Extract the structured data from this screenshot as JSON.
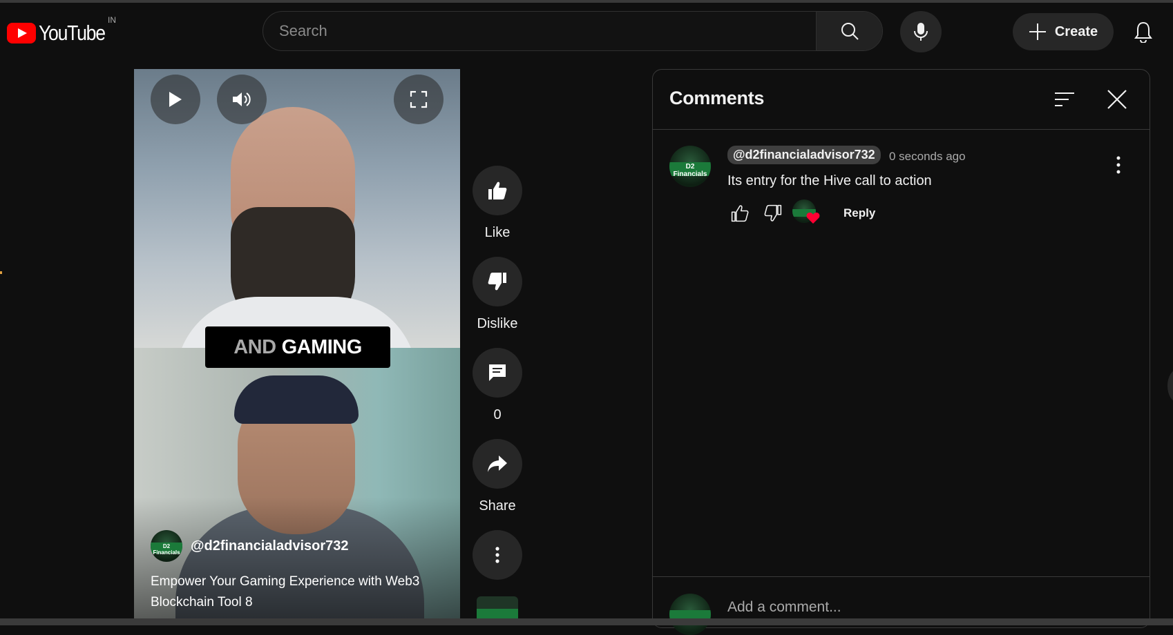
{
  "header": {
    "logo_text": "YouTube",
    "region": "IN",
    "search_placeholder": "Search",
    "create_label": "Create"
  },
  "video": {
    "caption_part1": "AND",
    "caption_part2": "GAMING",
    "channel": "@d2financialadvisor732",
    "title": "Empower Your Gaming Experience with Web3 Blockchain Tool 8"
  },
  "actions": {
    "like_label": "Like",
    "dislike_label": "Dislike",
    "comments_count": "0",
    "share_label": "Share"
  },
  "comments": {
    "title": "Comments",
    "items": [
      {
        "author": "@d2financialadvisor732",
        "time": "0 seconds ago",
        "text": "Its entry for the Hive call to action",
        "reply_label": "Reply"
      }
    ],
    "add_placeholder": "Add a comment..."
  },
  "avatar": {
    "line1": "D2",
    "line2": "Financials"
  },
  "colors": {
    "brand_red": "#ff0000",
    "background": "#0f0f0f",
    "surface": "#272727",
    "heart": "#ff0033"
  },
  "icons": [
    "play-icon",
    "volume-icon",
    "fullscreen-icon",
    "thumb-up-icon",
    "thumb-down-icon",
    "comment-icon",
    "share-icon",
    "more-vert-icon",
    "search-icon",
    "mic-icon",
    "plus-icon",
    "bell-icon",
    "sort-icon",
    "close-icon",
    "heart-icon"
  ]
}
